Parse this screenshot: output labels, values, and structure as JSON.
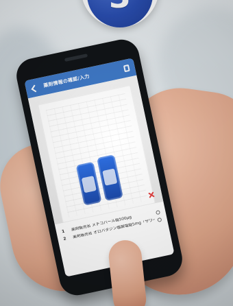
{
  "badge": {
    "number": "3",
    "color": "#2a4fb3"
  },
  "app": {
    "header_color": "#3f79c7",
    "title": "薬剤情報の確認/入力",
    "icons": {
      "back": "back-arrow-icon",
      "top_right": "device-icon",
      "close": "close-icon",
      "row_info": "info-icon"
    }
  },
  "results": {
    "items": [
      {
        "index": "1",
        "text": "薬剤販売名 メチコバール錠500μg"
      },
      {
        "index": "2",
        "text": "薬剤販売名 オロパタジン塩酸塩錠5mg「サワイ」"
      }
    ]
  }
}
